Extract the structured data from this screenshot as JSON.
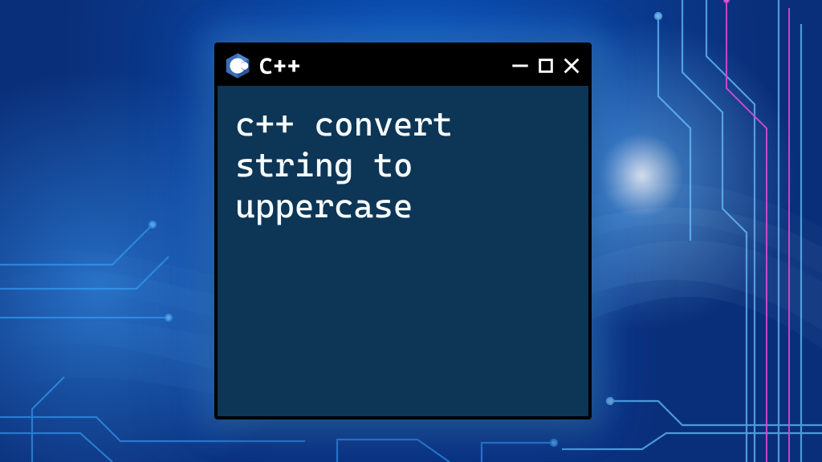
{
  "window": {
    "title": "C++",
    "body_text": "c++ convert\nstring to\nuppercase",
    "logo_name": "cpp-logo"
  },
  "colors": {
    "window_bg": "#0d3555",
    "titlebar_bg": "#000000",
    "text": "#f5fbff"
  }
}
